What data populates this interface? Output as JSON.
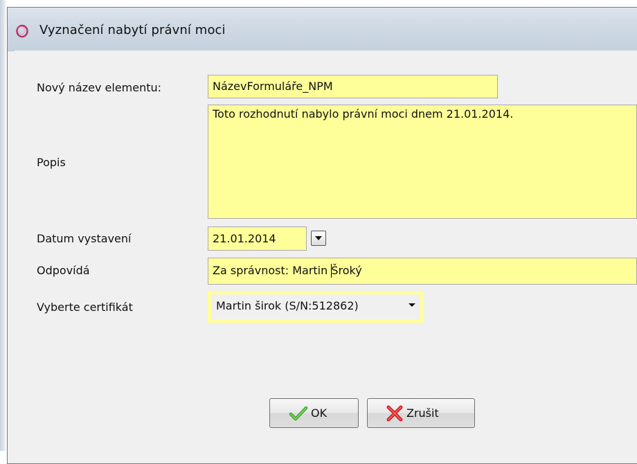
{
  "window": {
    "title": "Vyznačení nabytí právní moci"
  },
  "form": {
    "name_label": "Nový název elementu:",
    "name_value": "NázevFormuláře_NPM",
    "description_label": "Popis",
    "description_value": "Toto rozhodnutí nabylo právní moci dnem 21.01.2014.",
    "date_label": "Datum vystavení",
    "date_value": "21.01.2014",
    "responsible_label": "Odpovídá",
    "responsible_value": "Za správnost: Martin Šroký",
    "certificate_label": "Vyberte certifikát",
    "certificate_value": "Martin širok (S/N:512862)"
  },
  "buttons": {
    "ok_label": "OK",
    "cancel_label": "Zrušit"
  },
  "colors": {
    "field_background": "#ffff99",
    "titlebar": "#cfd9e4",
    "ok_check": "#3aa52a",
    "cancel_x": "#d62020"
  },
  "icons": {
    "app": "ring-icon",
    "calendar": "chevron-down-icon",
    "ok": "checkmark-icon",
    "cancel": "x-icon"
  }
}
